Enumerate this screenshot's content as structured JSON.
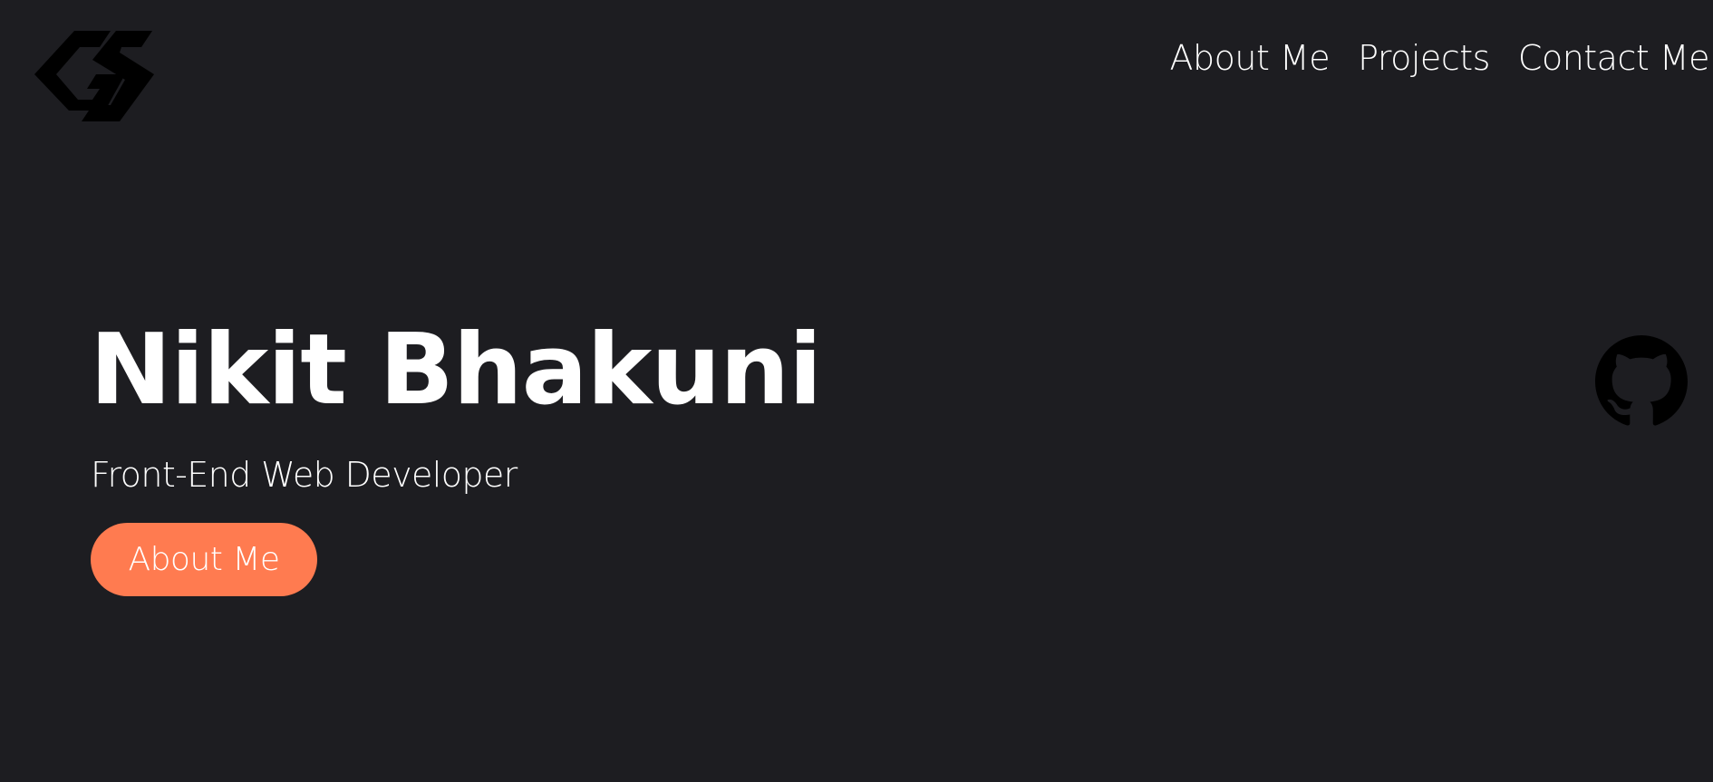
{
  "header": {
    "logo_icon": "gs-monogram-logo-icon",
    "nav": [
      {
        "label": "About Me"
      },
      {
        "label": "Projects"
      },
      {
        "label": "Contact Me"
      }
    ]
  },
  "hero": {
    "name": "Nikit Bhakuni",
    "subtitle": "Front-End Web Developer",
    "button_label": "About Me"
  },
  "social": {
    "github_icon": "github-icon"
  },
  "colors": {
    "background": "#1d1d21",
    "text": "#ffffff",
    "accent": "#ff7b50",
    "icon": "#000000"
  }
}
